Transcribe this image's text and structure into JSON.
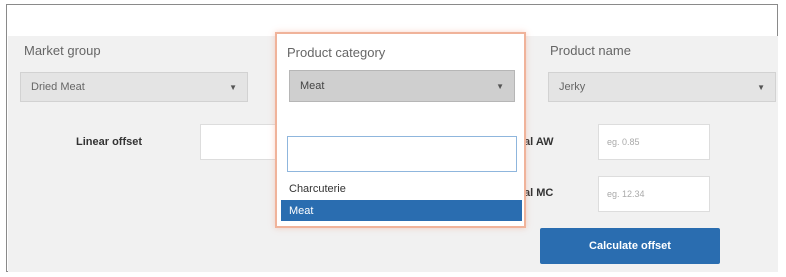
{
  "form": {
    "market_group": {
      "label": "Market group",
      "value": "Dried Meat"
    },
    "product_category": {
      "label": "Product category",
      "value": "Meat"
    },
    "product_name": {
      "label": "Product name",
      "value": "Jerky"
    },
    "linear_offset_label": "Linear offset",
    "row2_label": "al AW",
    "row2_placeholder": "eg. 0.85",
    "row3_label": "al MC",
    "row3_placeholder": "eg. 12.34",
    "calculate_button": "Calculate offset"
  },
  "dropdown": {
    "search_value": "",
    "options": [
      {
        "label": "Charcuterie",
        "selected": false
      },
      {
        "label": "Meat",
        "selected": true
      }
    ]
  },
  "colors": {
    "accent": "#2a6db0",
    "highlight_border": "#f0b39a"
  }
}
